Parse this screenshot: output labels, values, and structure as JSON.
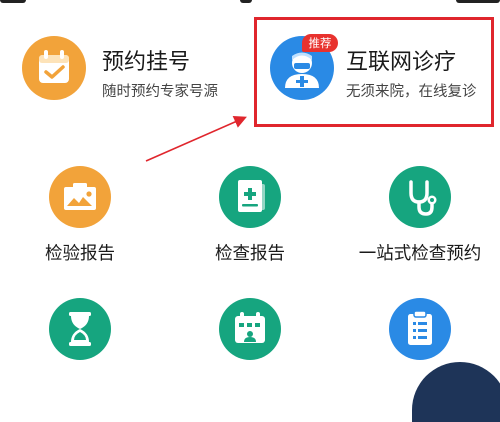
{
  "cards": [
    {
      "title": "预约挂号",
      "subtitle": "随时预约专家号源",
      "icon": "calendar-check-icon",
      "color": "#f2a33a"
    },
    {
      "title": "互联网诊疗",
      "subtitle": "无须来院，在线复诊",
      "icon": "doctor-icon",
      "color": "#2a8ae5",
      "badge": "推荐"
    }
  ],
  "grid_row1": [
    {
      "label": "检验报告",
      "icon": "test-report-icon",
      "color": "#f2a33a"
    },
    {
      "label": "检查报告",
      "icon": "medical-report-icon",
      "color": "#16a57f"
    },
    {
      "label": "一站式检查预约",
      "icon": "stethoscope-icon",
      "color": "#16a57f"
    }
  ],
  "grid_row2": [
    {
      "label": "",
      "icon": "hourglass-icon",
      "color": "#16a57f"
    },
    {
      "label": "",
      "icon": "schedule-icon",
      "color": "#16a57f"
    },
    {
      "label": "",
      "icon": "clipboard-icon",
      "color": "#2a8ae5"
    }
  ],
  "annotation": {
    "highlight_color": "#e0262d"
  }
}
